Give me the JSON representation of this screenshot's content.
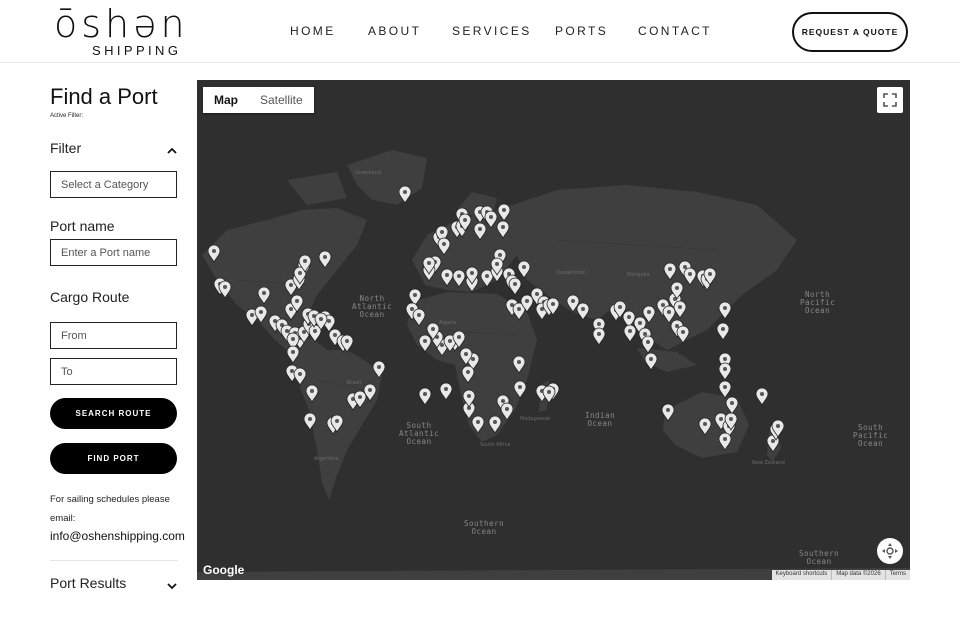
{
  "brand": {
    "name": "ōshən",
    "tagline": "SHIPPING"
  },
  "nav": {
    "links": [
      {
        "label": "HOME"
      },
      {
        "label": "ABOUT"
      },
      {
        "label": "SERVICES"
      },
      {
        "label": "PORTS"
      },
      {
        "label": "CONTACT"
      }
    ],
    "cta": "REQUEST A QUOTE"
  },
  "sidebar": {
    "title": "Find a Port",
    "active_filter": "Active Filter:",
    "filter_label": "Filter",
    "category_placeholder": "Select a Category",
    "port_name_label": "Port name",
    "port_name_placeholder": "Enter a Port name",
    "cargo_route_label": "Cargo Route",
    "from_placeholder": "From",
    "to_placeholder": "To",
    "search_route_button": "SEARCH ROUTE",
    "find_port_button": "FIND PORT",
    "sailing_note": "For sailing schedules please",
    "email_note": "email:",
    "email": "info@oshenshipping.com",
    "results_label": "Port Results"
  },
  "map": {
    "type_map": "Map",
    "type_satellite": "Satellite",
    "google": "Google",
    "attribution": {
      "shortcuts": "Keyboard shortcuts",
      "data": "Map data ©2026",
      "terms": "Terms"
    },
    "oceans": {
      "north_atlantic": "North\nAtlantic\nOcean",
      "south_atlantic": "South\nAtlantic\nOcean",
      "indian": "Indian\nOcean",
      "north_pacific": "North\nPacific\nOcean",
      "south_pacific": "South\nPacific\nOcean",
      "southern_1": "Southern\nOcean",
      "southern_2": "Southern\nOcean"
    },
    "places": {
      "greenland": "Greenland",
      "kazakhstan": "Kazakhstan",
      "mongolia": "Mongolia",
      "algeria": "Algeria",
      "madagascar": "Madagascar",
      "south_africa": "South Africa",
      "argentina": "Argentina",
      "brazil": "Brazil",
      "new_zealand": "New Zealand"
    },
    "colors": {
      "water": "#2f2f2f",
      "land": "#3f3f3f",
      "pin": "#e8e8e8"
    }
  }
}
